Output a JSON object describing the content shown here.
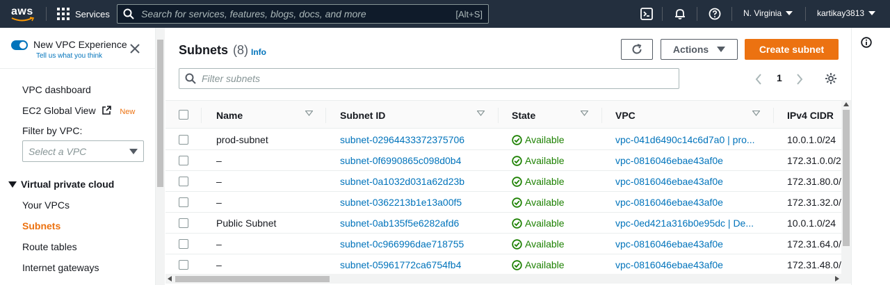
{
  "topnav": {
    "logo_text": "aws",
    "services_label": "Services",
    "search_placeholder": "Search for services, features, blogs, docs, and more",
    "search_shortcut": "[Alt+S]",
    "region": "N. Virginia",
    "account": "kartikay3813",
    "icons": [
      "cloudshell-icon",
      "bell-icon",
      "help-icon"
    ]
  },
  "sidebar": {
    "vpc_experience_title": "New VPC Experience",
    "vpc_experience_sub": "Tell us what you think",
    "links_top": [
      {
        "label": "VPC dashboard"
      },
      {
        "label": "EC2 Global View",
        "badge": "New"
      }
    ],
    "filter_label": "Filter by VPC:",
    "filter_placeholder": "Select a VPC",
    "section_title": "Virtual private cloud",
    "section_links": [
      "Your VPCs",
      "Subnets",
      "Route tables",
      "Internet gateways"
    ],
    "active_link": "Subnets"
  },
  "main": {
    "title": "Subnets",
    "count": "(8)",
    "info": "Info",
    "actions_label": "Actions",
    "create_label": "Create subnet",
    "filter_placeholder": "Filter subnets",
    "page_number": "1"
  },
  "table": {
    "columns": [
      "Name",
      "Subnet ID",
      "State",
      "VPC",
      "IPv4 CIDR"
    ],
    "rows": [
      {
        "name": "prod-subnet",
        "subnet_id": "subnet-02964433372375706",
        "state": "Available",
        "vpc": "vpc-041d6490c14c6d7a0 | pro...",
        "cidr": "10.0.1.0/24"
      },
      {
        "name": "–",
        "subnet_id": "subnet-0f6990865c098d0b4",
        "state": "Available",
        "vpc": "vpc-0816046ebae43af0e",
        "cidr": "172.31.0.0/2"
      },
      {
        "name": "–",
        "subnet_id": "subnet-0a1032d031a62d23b",
        "state": "Available",
        "vpc": "vpc-0816046ebae43af0e",
        "cidr": "172.31.80.0/"
      },
      {
        "name": "–",
        "subnet_id": "subnet-0362213b1e13a00f5",
        "state": "Available",
        "vpc": "vpc-0816046ebae43af0e",
        "cidr": "172.31.32.0/"
      },
      {
        "name": "Public Subnet",
        "subnet_id": "subnet-0ab135f5e6282afd6",
        "state": "Available",
        "vpc": "vpc-0ed421a316b0e95dc | De...",
        "cidr": "10.0.1.0/24"
      },
      {
        "name": "–",
        "subnet_id": "subnet-0c966996dae718755",
        "state": "Available",
        "vpc": "vpc-0816046ebae43af0e",
        "cidr": "172.31.64.0/"
      },
      {
        "name": "–",
        "subnet_id": "subnet-05961772ca6754fb4",
        "state": "Available",
        "vpc": "vpc-0816046ebae43af0e",
        "cidr": "172.31.48.0/"
      }
    ]
  },
  "colors": {
    "nav_bg": "#232f3e",
    "accent_orange": "#ec7211",
    "link_blue": "#0073bb",
    "available_green": "#1d8102"
  }
}
